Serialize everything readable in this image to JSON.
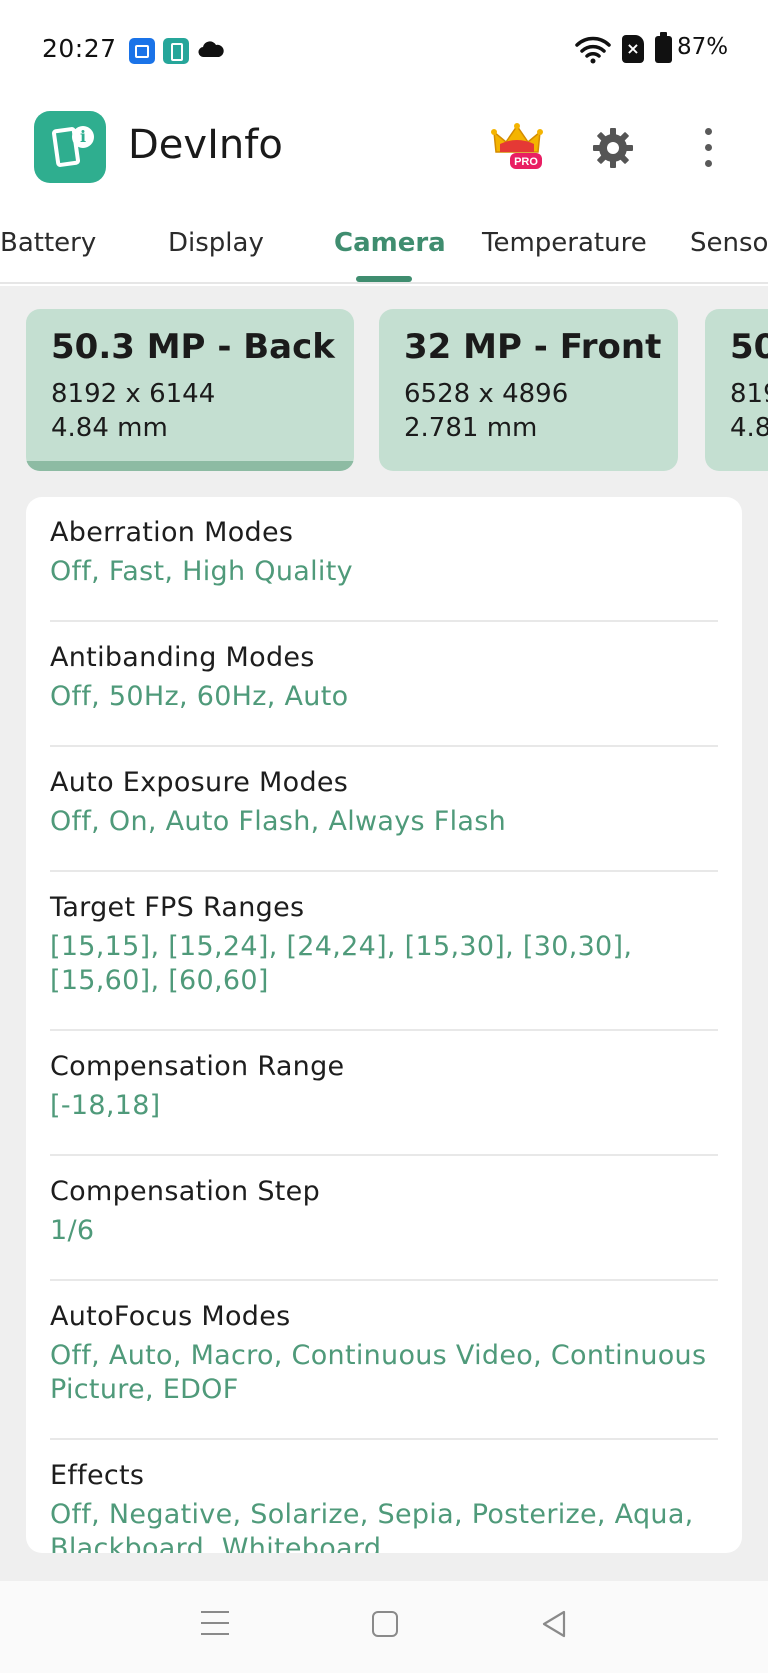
{
  "status_bar": {
    "time": "20:27",
    "battery": "87%",
    "icons": [
      "app-notification-icon",
      "app-notification-icon",
      "cloud-icon",
      "wifi-icon",
      "no-sim-icon",
      "battery-icon"
    ]
  },
  "app_bar": {
    "title": "DevInfo",
    "pro_badge": "PRO",
    "icons": [
      "app-logo-icon",
      "pro-crown-icon",
      "gear-icon",
      "more-vert-icon"
    ]
  },
  "tabs": [
    {
      "label": "Battery"
    },
    {
      "label": "Display"
    },
    {
      "label": "Camera",
      "active": true
    },
    {
      "label": "Temperature"
    },
    {
      "label": "Senso"
    }
  ],
  "cameras": [
    {
      "title": "50.3 MP - Back",
      "resolution": "8192 x 6144",
      "focal": "4.84 mm",
      "selected": true
    },
    {
      "title": "32 MP - Front",
      "resolution": "6528 x 4896",
      "focal": "2.781 mm",
      "selected": false
    },
    {
      "title": "50",
      "resolution": "819",
      "focal": "4.8",
      "selected": false
    }
  ],
  "properties": [
    {
      "label": "Aberration Modes",
      "value": "Off, Fast, High Quality"
    },
    {
      "label": "Antibanding Modes",
      "value": "Off, 50Hz, 60Hz, Auto"
    },
    {
      "label": "Auto Exposure Modes",
      "value": "Off, On, Auto Flash, Always Flash"
    },
    {
      "label": "Target FPS Ranges",
      "value": "[15,15], [15,24], [24,24], [15,30], [30,30], [15,60], [60,60]"
    },
    {
      "label": "Compensation Range",
      "value": "[-18,18]"
    },
    {
      "label": "Compensation Step",
      "value": "1/6"
    },
    {
      "label": "AutoFocus Modes",
      "value": "Off, Auto, Macro, Continuous Video, Continuous Picture, EDOF"
    },
    {
      "label": "Effects",
      "value": "Off, Negative, Solarize, Sepia, Posterize, Aqua, Blackboard, Whiteboard"
    }
  ],
  "colors": {
    "accent": "#3f8d6f",
    "value_text": "#4f9a7a",
    "card_bg": "#c4dfd1",
    "app_logo": "#2fae8f"
  },
  "nav_bar": {
    "icons": [
      "menu-icon",
      "home-icon",
      "back-icon"
    ]
  }
}
